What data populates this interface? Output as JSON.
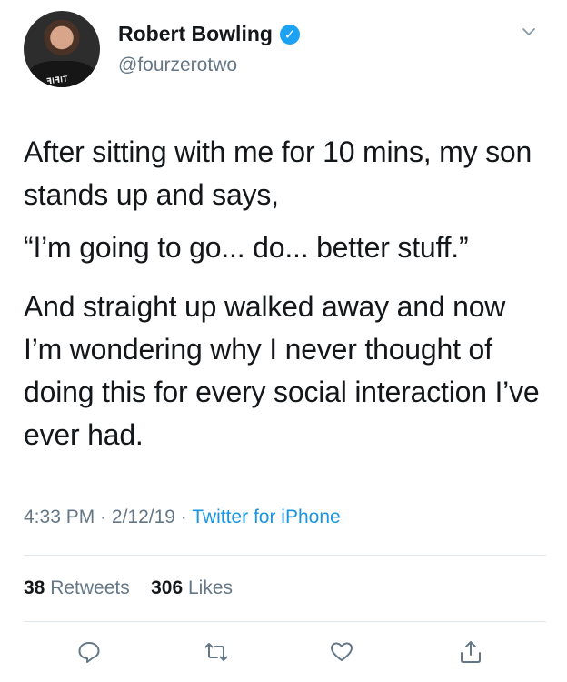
{
  "user": {
    "name": "Robert Bowling",
    "handle": "@fourzerotwo",
    "avatar_shirt_text": "ꟻIꟻIT"
  },
  "tweet": {
    "paragraphs": [
      "After sitting with me for 10 mins, my son stands up and says,",
      "“I’m going to go... do... better stuff.”",
      "And straight up walked away and now I’m wondering why I never thought of doing this for every social interaction I’ve ever had."
    ]
  },
  "meta": {
    "time": "4:33 PM",
    "date": "2/12/19",
    "separator": " · ",
    "source": "Twitter for iPhone"
  },
  "stats": {
    "retweets_count": "38",
    "retweets_label": "Retweets",
    "likes_count": "306",
    "likes_label": "Likes"
  },
  "colors": {
    "verified": "#1da1f2",
    "link": "#1b95e0",
    "muted": "#657786"
  },
  "icons": [
    "verified-badge-icon",
    "chevron-down-icon",
    "reply-icon",
    "retweet-icon",
    "like-icon",
    "share-icon"
  ]
}
